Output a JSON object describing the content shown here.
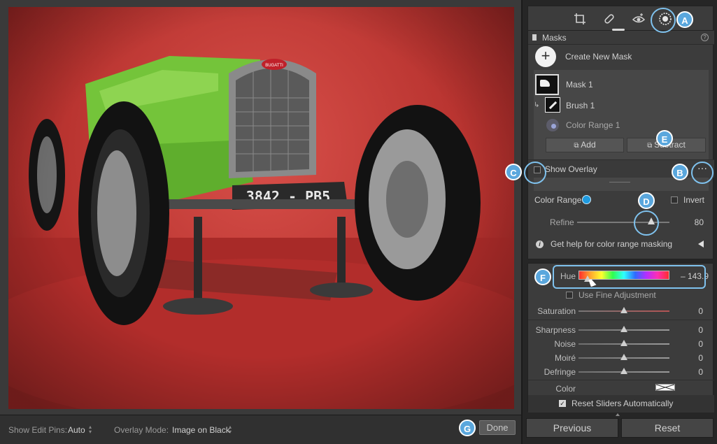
{
  "image": {
    "plate_text": "3842 - PB5",
    "badge_text": "BUGATTI"
  },
  "bottom_bar": {
    "edit_pins_label": "Show Edit Pins:",
    "edit_pins_value": "Auto",
    "overlay_mode_label": "Overlay Mode:",
    "overlay_mode_value": "Image on Black",
    "done_label": "Done"
  },
  "tools": [
    "crop-icon",
    "heal-icon",
    "red-eye-icon",
    "masking-icon"
  ],
  "masks": {
    "header": "Masks",
    "create_new": "Create New Mask",
    "mask_name": "Mask 1",
    "brush_name": "Brush 1",
    "color_range_name": "Color Range 1",
    "add_label": "Add",
    "subtract_label": "Subtract",
    "show_overlay_label": "Show Overlay",
    "show_overlay_checked": false
  },
  "color_range": {
    "label": "Color Range",
    "invert_label": "Invert",
    "refine_label": "Refine",
    "refine_value": "80",
    "refine_fraction": 0.8,
    "help_text": "Get help for color range masking"
  },
  "details": {
    "hue_label": "Hue",
    "hue_value": "– 143.9",
    "hue_fraction": 0.1,
    "fine_adjust_label": "Use Fine Adjustment",
    "saturation_label": "Saturation",
    "saturation_value": "0",
    "sharpness_label": "Sharpness",
    "sharpness_value": "0",
    "noise_label": "Noise",
    "noise_value": "0",
    "moire_label": "Moiré",
    "moire_value": "0",
    "defringe_label": "Defringe",
    "defringe_value": "0",
    "color_label": "Color",
    "reset_sliders_label": "Reset Sliders Automatically",
    "reset_sliders_checked": true
  },
  "footer": {
    "previous_label": "Previous",
    "reset_label": "Reset"
  },
  "callouts": {
    "a": "A",
    "b": "B",
    "c": "C",
    "d": "D",
    "e": "E",
    "f": "F",
    "g": "G"
  },
  "colors": {
    "accent": "#5aa7dd",
    "car_green": "#74c43a",
    "backdrop_red": "#c23a34",
    "color_range_dot": "#1f9be0"
  }
}
